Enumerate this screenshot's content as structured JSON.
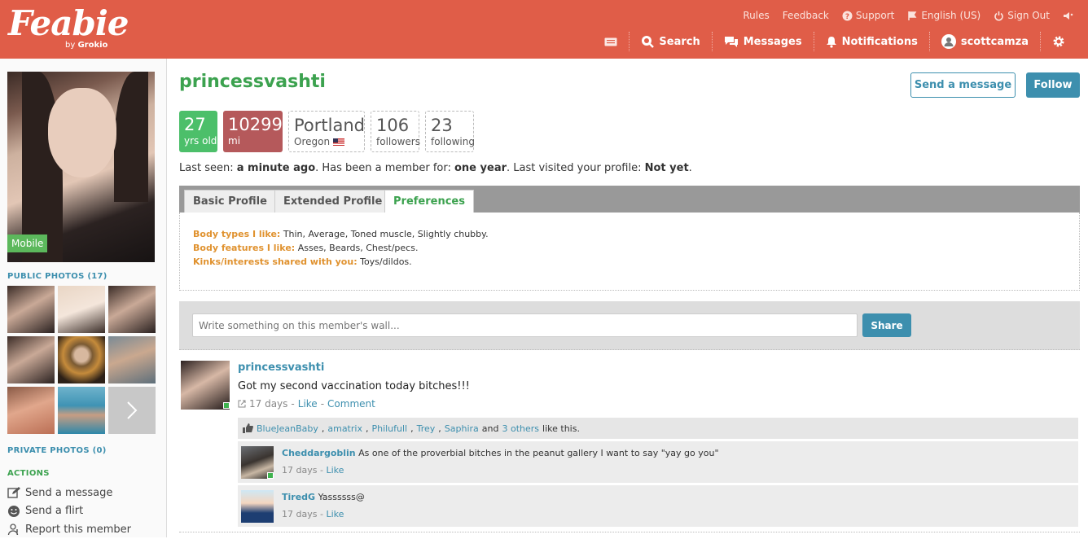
{
  "header": {
    "logo_text": "Feabie",
    "logo_by": "by",
    "logo_brand": "Grokio",
    "top_links": {
      "rules": "Rules",
      "feedback": "Feedback",
      "support": "Support",
      "language": "English (US)",
      "sign_out": "Sign Out"
    },
    "nav": {
      "search": "Search",
      "messages": "Messages",
      "notifications": "Notifications",
      "user": "scottcamza"
    }
  },
  "sidebar": {
    "mobile_badge": "Mobile",
    "public_photos": "PUBLIC PHOTOS (17)",
    "private_photos": "PRIVATE PHOTOS (0)",
    "actions_title": "ACTIONS",
    "actions": {
      "send_message": "Send a message",
      "send_flirt": "Send a flirt",
      "report": "Report this member"
    }
  },
  "profile": {
    "username": "princessvashti",
    "send_message_button": "Send a message",
    "follow_button": "Follow",
    "stats": {
      "age": "27",
      "age_label": "yrs old",
      "distance": "10299",
      "distance_label": "mi",
      "city": "Portland",
      "state": "Oregon",
      "followers": "106",
      "followers_label": "followers",
      "following": "23",
      "following_label": "following"
    },
    "last_seen": {
      "prefix": "Last seen:",
      "value": "a minute ago",
      "member_prefix": ". Has been a member for:",
      "member_value": "one year",
      "visited_prefix": ". Last visited your profile:",
      "visited_value": "Not yet",
      "end": "."
    }
  },
  "tabs": {
    "basic": "Basic Profile",
    "extended": "Extended Profile",
    "preferences": "Preferences"
  },
  "preferences": {
    "body_types_label": "Body types I like:",
    "body_types": "Thin, Average, Toned muscle, Slightly chubby.",
    "body_features_label": "Body features I like:",
    "body_features": "Asses, Beards, Chest/pecs.",
    "kinks_label": "Kinks/interests shared with you:",
    "kinks": "Toys/dildos."
  },
  "wall": {
    "placeholder": "Write something on this member's wall...",
    "share_button": "Share"
  },
  "post": {
    "author": "princessvashti",
    "text": "Got my second vaccination today bitches!!!",
    "age": "17 days",
    "like": "Like",
    "comment": "Comment",
    "likers": [
      "BlueJeanBaby",
      "amatrix",
      "Philufull",
      "Trey",
      "Saphira"
    ],
    "and": "and",
    "others": "3 others",
    "like_suffix": "like this.",
    "comments": [
      {
        "author": "Cheddargoblin",
        "text": "As one of the proverbial bitches in the peanut gallery I want to say \"yay go you\"",
        "age": "17 days",
        "like": "Like"
      },
      {
        "author": "TiredG",
        "text": "Yassssss@",
        "age": "17 days",
        "like": "Like"
      }
    ]
  },
  "colors": {
    "header": "#e05d48",
    "accent_blue": "#3d8fae",
    "accent_green": "#3ca24f",
    "age_box": "#4cbf6a",
    "distance_box": "#b5595b",
    "pref_label": "#e0922f"
  }
}
